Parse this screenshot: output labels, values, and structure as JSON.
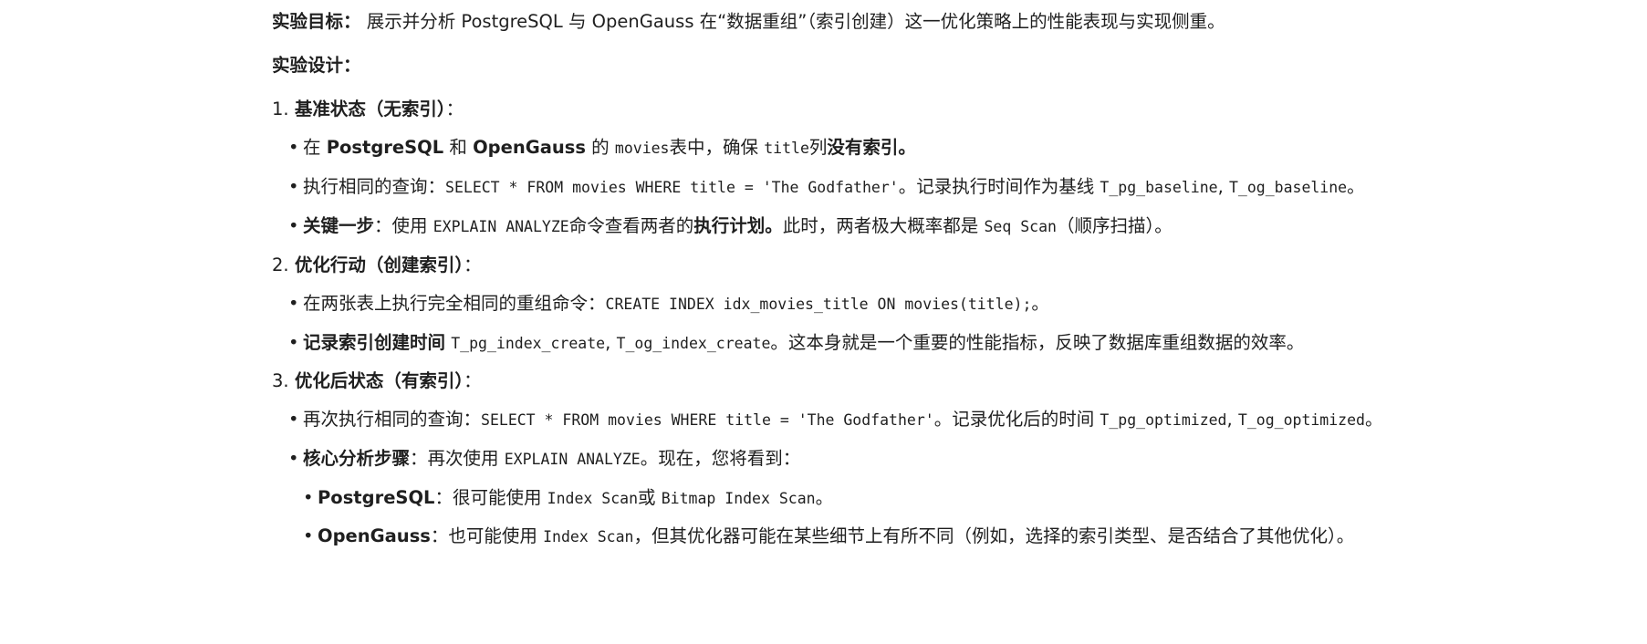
{
  "objective": {
    "label": "实验目标：",
    "text": " 展示并分析 PostgreSQL 与 OpenGauss 在“数据重组”（索引创建）这一优化策略上的性能表现与实现侧重。"
  },
  "design": {
    "label": "实验设计："
  },
  "step1": {
    "number": "1. ",
    "title": "基准状态（无索引）",
    "suffix": "：",
    "bullets": [
      {
        "dot": "•",
        "t1": "在 ",
        "b1": "PostgreSQL",
        "t2": " 和 ",
        "b2": "OpenGauss",
        "t3": " 的 ",
        "c1": "movies",
        "t4": "表中，确保 ",
        "c2": "title",
        "t5": "列",
        "b3": "没有索引。"
      },
      {
        "dot": "•",
        "t1": "执行相同的查询：",
        "c1": "SELECT * FROM movies WHERE title = 'The Godfather'",
        "t2": "。记录执行时间作为基线 ",
        "c2": "T_pg_baseline",
        "t3": ", ",
        "c3": "T_og_baseline",
        "t4": "。"
      },
      {
        "dot": "•",
        "b1": "关键一步",
        "t1": "：使用 ",
        "c1": "EXPLAIN ANALYZE",
        "t2": "命令查看两者的",
        "b2": "执行计划。",
        "t3": "此时，两者极大概率都是 ",
        "c2": "Seq Scan",
        "t4": "（顺序扫描）。"
      }
    ]
  },
  "step2": {
    "number": "2. ",
    "title": "优化行动（创建索引）",
    "suffix": "：",
    "bullets": [
      {
        "dot": "•",
        "t1": "在两张表上执行完全相同的重组命令：",
        "c1": "CREATE INDEX idx_movies_title ON movies(title);",
        "t2": "。"
      },
      {
        "dot": "•",
        "b1": "记录索引创建时间",
        "t1": " ",
        "c1": "T_pg_index_create",
        "t2": ", ",
        "c2": "T_og_index_create",
        "t3": "。这本身就是一个重要的性能指标，反映了数据库重组数据的效率。"
      }
    ]
  },
  "step3": {
    "number": "3. ",
    "title": "优化后状态（有索引）",
    "suffix": "：",
    "bullets": [
      {
        "dot": "•",
        "t1": "再次执行相同的查询：",
        "c1": "SELECT * FROM movies WHERE title = 'The Godfather'",
        "t2": "。记录优化后的时间 ",
        "c2": "T_pg_optimized",
        "t3": ", ",
        "c3": "T_og_optimized",
        "t4": "。"
      },
      {
        "dot": "•",
        "b1": "核心分析步骤",
        "t1": "：再次使用 ",
        "c1": "EXPLAIN ANALYZE",
        "t2": "。现在，您将看到："
      }
    ],
    "subbullets": [
      {
        "dot": "•",
        "b1": "PostgreSQL",
        "t1": "：很可能使用 ",
        "c1": "Index Scan",
        "t2": "或 ",
        "c2": "Bitmap Index Scan",
        "t3": "。"
      },
      {
        "dot": "•",
        "b1": "OpenGauss",
        "t1": "：也可能使用 ",
        "c1": "Index Scan",
        "t2": "，但其优化器可能在某些细节上有所不同（例如，选择的索引类型、是否结合了其他优化）。"
      }
    ]
  }
}
